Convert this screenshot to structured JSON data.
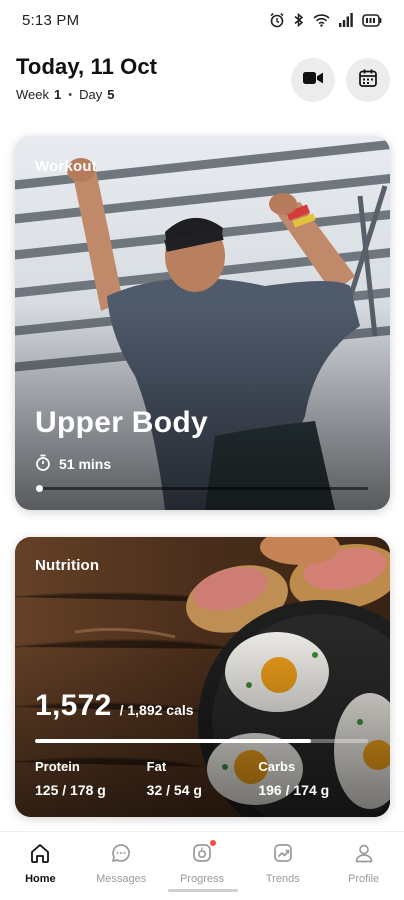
{
  "status_bar": {
    "time": "5:13 PM"
  },
  "header": {
    "date_title": "Today, 11 Oct",
    "week_label": "Week",
    "week_value": "1",
    "day_label": "Day",
    "day_value": "5",
    "video_button_icon": "video-camera-icon",
    "calendar_button_icon": "calendar-icon"
  },
  "workout": {
    "label": "Workout",
    "title": "Upper Body",
    "duration": "51 mins",
    "progress": 0.0
  },
  "nutrition": {
    "label": "Nutrition",
    "calories": "1,572",
    "calories_target": "/ 1,892 cals",
    "calories_fraction": 0.83,
    "macros": [
      {
        "name": "Protein",
        "value": "125",
        "target": "/ 178 g"
      },
      {
        "name": "Fat",
        "value": "32",
        "target": "/ 54 g"
      },
      {
        "name": "Carbs",
        "value": "196",
        "target": "/ 174 g"
      }
    ]
  },
  "nav": {
    "items": [
      {
        "label": "Home",
        "icon": "home-icon",
        "active": true
      },
      {
        "label": "Messages",
        "icon": "chat-bubble-icon",
        "active": false
      },
      {
        "label": "Progress",
        "icon": "progress-icon",
        "active": false,
        "badge": true
      },
      {
        "label": "Trends",
        "icon": "trends-icon",
        "active": false
      },
      {
        "label": "Profile",
        "icon": "person-icon",
        "active": false
      }
    ]
  },
  "colors": {
    "badge": "#ff4a3d",
    "nav_inactive": "#9a9a9a",
    "nav_active": "#111111"
  }
}
